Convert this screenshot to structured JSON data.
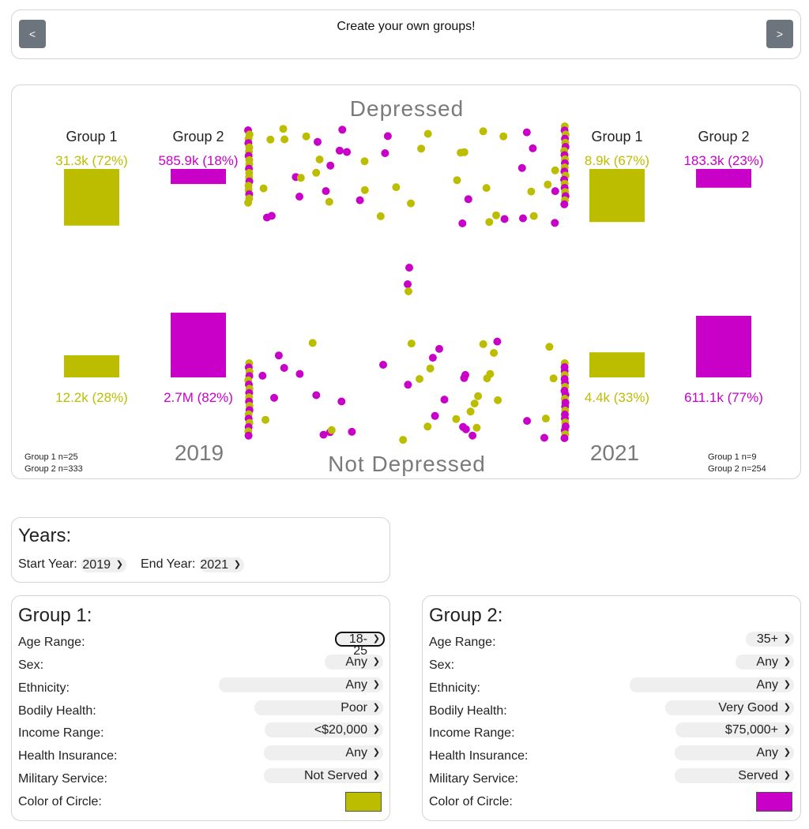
{
  "header": {
    "title": "Create your own groups!",
    "prev_label": "<",
    "next_label": ">"
  },
  "colors": {
    "group1": "#bdbd00",
    "group2": "#c800c8",
    "label_gray": "#7a7a7a"
  },
  "chart": {
    "top_label": "Depressed",
    "bottom_label": "Not Depressed",
    "left_panel": {
      "year": "2019",
      "group1": {
        "name": "Group 1",
        "depressed": "31.3k (72%)",
        "not_depressed": "12.2k (28%)",
        "depressed_value": 31.3,
        "not_depressed_value": 12.2
      },
      "group2": {
        "name": "Group 2",
        "depressed": "585.9k (18%)",
        "not_depressed": "2.7M (82%)",
        "depressed_value": 585.9,
        "not_depressed_value": 2700
      },
      "n_group1": "Group 1 n=25",
      "n_group2": "Group 2 n=333"
    },
    "right_panel": {
      "year": "2021",
      "group1": {
        "name": "Group 1",
        "depressed": "8.9k (67%)",
        "not_depressed": "4.4k (33%)",
        "depressed_value": 8.9,
        "not_depressed_value": 4.4
      },
      "group2": {
        "name": "Group 2",
        "depressed": "183.3k (23%)",
        "not_depressed": "611.1k (77%)",
        "depressed_value": 183.3,
        "not_depressed_value": 611.1
      },
      "n_group1": "Group 1 n=9",
      "n_group2": "Group 2 n=254"
    }
  },
  "years": {
    "title": "Years:",
    "start_label": "Start Year:",
    "start_value": "2019",
    "end_label": "End Year:",
    "end_value": "2021"
  },
  "group1_form": {
    "title": "Group 1:",
    "fields": [
      {
        "label": "Age Range:",
        "value": "18-25"
      },
      {
        "label": "Sex:",
        "value": "Any"
      },
      {
        "label": "Ethnicity:",
        "value": "Any"
      },
      {
        "label": "Bodily Health:",
        "value": "Poor"
      },
      {
        "label": "Income Range:",
        "value": "<$20,000"
      },
      {
        "label": "Health Insurance:",
        "value": "Any"
      },
      {
        "label": "Military Service:",
        "value": "Not Served"
      }
    ],
    "color_label": "Color of Circle:",
    "color": "#bdbd00"
  },
  "group2_form": {
    "title": "Group 2:",
    "fields": [
      {
        "label": "Age Range:",
        "value": "35+"
      },
      {
        "label": "Sex:",
        "value": "Any"
      },
      {
        "label": "Ethnicity:",
        "value": "Any"
      },
      {
        "label": "Bodily Health:",
        "value": "Very Good"
      },
      {
        "label": "Income Range:",
        "value": "$75,000+"
      },
      {
        "label": "Health Insurance:",
        "value": "Any"
      },
      {
        "label": "Military Service:",
        "value": "Served"
      }
    ],
    "color_label": "Color of Circle:",
    "color": "#c800c8"
  },
  "icons": {
    "dropdown": "chevron-down-icon"
  }
}
